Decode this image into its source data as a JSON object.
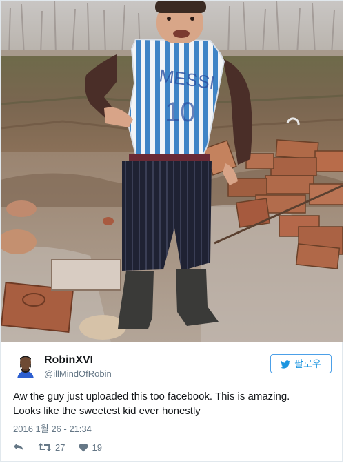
{
  "tweet": {
    "display_name": "RobinXVI",
    "handle": "@illMindOfRobin",
    "follow_label": "팔로우",
    "text_line1": "Aw the guy just uploaded this too facebook. This is amazing.",
    "text_line2": "Looks like the sweetest kid ever honestly",
    "timestamp": "2016 1월 26 - 21:34",
    "retweet_count": "27",
    "like_count": "19"
  },
  "icons": {
    "follow": "twitter-bird-icon",
    "reply": "reply-icon",
    "retweet": "retweet-icon",
    "like": "heart-icon"
  },
  "colors": {
    "accent": "#1b95e0",
    "text": "#14171a",
    "muted": "#657786",
    "border": "#e1e8ed"
  }
}
